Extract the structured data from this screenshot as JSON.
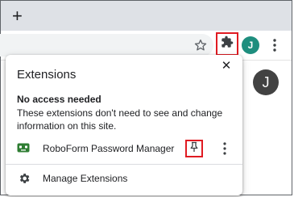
{
  "browser": {
    "new_tab_glyph": "+",
    "profile_initial": "J",
    "icons": [
      "plus-icon",
      "star-icon",
      "extensions-puzzle-icon",
      "profile-avatar",
      "more-vert-icon"
    ],
    "colors": {
      "highlight": "#e01b22",
      "avatar_small": "#1e8e7e",
      "avatar_page": "#424242"
    }
  },
  "page": {
    "avatar_initial": "J"
  },
  "popup": {
    "title": "Extensions",
    "close_glyph": "✕",
    "section_heading": "No access needed",
    "section_description": "These extensions don't need to see and change information on this site.",
    "extensions": [
      {
        "name": "RoboForm Password Manager",
        "icon": "roboform-icon",
        "pinned": false
      }
    ],
    "manage_label": "Manage Extensions"
  }
}
